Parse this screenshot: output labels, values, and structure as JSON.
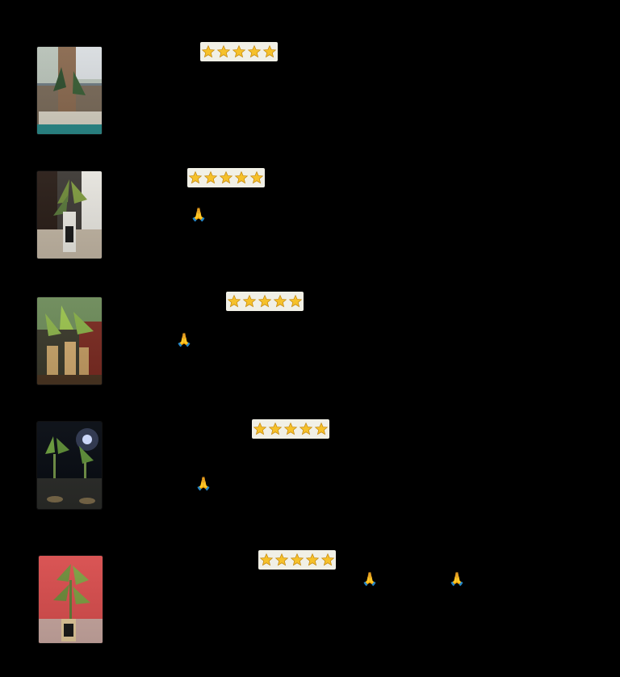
{
  "reviews": [
    {
      "rating": 5,
      "emojis": []
    },
    {
      "rating": 5,
      "emojis": [
        "🙏"
      ]
    },
    {
      "rating": 5,
      "emojis": [
        "🙏"
      ]
    },
    {
      "rating": 5,
      "emojis": [
        "🙏"
      ]
    },
    {
      "rating": 5,
      "emojis": [
        "🙏",
        "🙏😊"
      ]
    }
  ],
  "icons": {
    "star": "star-icon",
    "pray": "folded-hands-emoji",
    "smile": "smiling-face-emoji"
  }
}
